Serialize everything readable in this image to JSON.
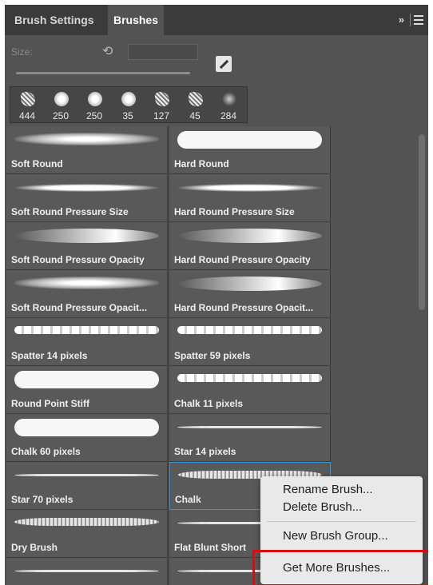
{
  "tabs": [
    {
      "label": "Brush Settings"
    },
    {
      "label": "Brushes"
    }
  ],
  "header_ext": "»",
  "size": {
    "label": "Size:",
    "value": ""
  },
  "recent_brushes": [
    {
      "size": "444"
    },
    {
      "size": "250"
    },
    {
      "size": "250"
    },
    {
      "size": "35"
    },
    {
      "size": "127"
    },
    {
      "size": "45"
    },
    {
      "size": "284"
    }
  ],
  "brushes": [
    {
      "name": "Soft Round"
    },
    {
      "name": "Hard Round"
    },
    {
      "name": "Soft Round Pressure Size"
    },
    {
      "name": "Hard Round Pressure Size"
    },
    {
      "name": "Soft Round Pressure Opacity"
    },
    {
      "name": "Hard Round Pressure Opacity"
    },
    {
      "name": "Soft Round Pressure Opacit..."
    },
    {
      "name": "Hard Round Pressure Opacit..."
    },
    {
      "name": "Spatter 14 pixels"
    },
    {
      "name": "Spatter 59 pixels"
    },
    {
      "name": "Round Point Stiff"
    },
    {
      "name": "Chalk 11 pixels"
    },
    {
      "name": "Chalk 60 pixels"
    },
    {
      "name": "Star 14 pixels"
    },
    {
      "name": "Star 70 pixels"
    },
    {
      "name": "Chalk"
    },
    {
      "name": "Dry Brush"
    },
    {
      "name": "Flat Blunt Short"
    }
  ],
  "context_menu": {
    "items": [
      "Rename Brush...",
      "Delete Brush...",
      "New Brush Group...",
      "Get More Brushes..."
    ]
  }
}
